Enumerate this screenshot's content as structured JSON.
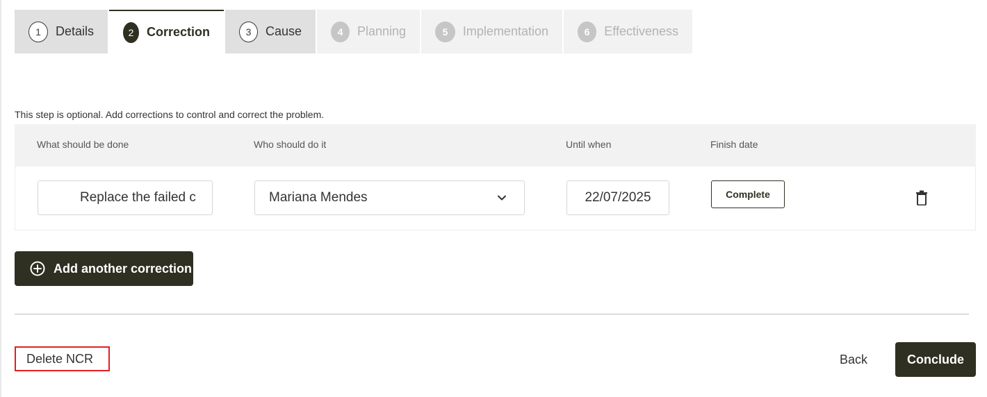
{
  "steps": [
    {
      "number": "1",
      "label": "Details",
      "state": "done"
    },
    {
      "number": "2",
      "label": "Correction",
      "state": "active"
    },
    {
      "number": "3",
      "label": "Cause",
      "state": "done"
    },
    {
      "number": "4",
      "label": "Planning",
      "state": "disabled"
    },
    {
      "number": "5",
      "label": "Implementation",
      "state": "disabled"
    },
    {
      "number": "6",
      "label": "Effectiveness",
      "state": "disabled"
    }
  ],
  "intro_text": "This step is optional. Add corrections to control and correct the problem.",
  "table": {
    "headers": {
      "what": "What should be done",
      "who": "Who should do it",
      "until": "Until when",
      "finish": "Finish date"
    },
    "rows": [
      {
        "what_value": "Replace the failed c",
        "who_value": "Mariana Mendes",
        "until_value": "22/07/2025",
        "finish_button": "Complete",
        "delete_icon": "trash-icon"
      }
    ]
  },
  "add_button_label": "Add another correction",
  "footer": {
    "delete_label": "Delete NCR",
    "back_label": "Back",
    "conclude_label": "Conclude"
  },
  "colors": {
    "primary": "#2f2f22",
    "highlight_border": "#e02020",
    "tab_done_bg": "#e0e0e0",
    "tab_disabled_bg": "#f2f2f2"
  }
}
